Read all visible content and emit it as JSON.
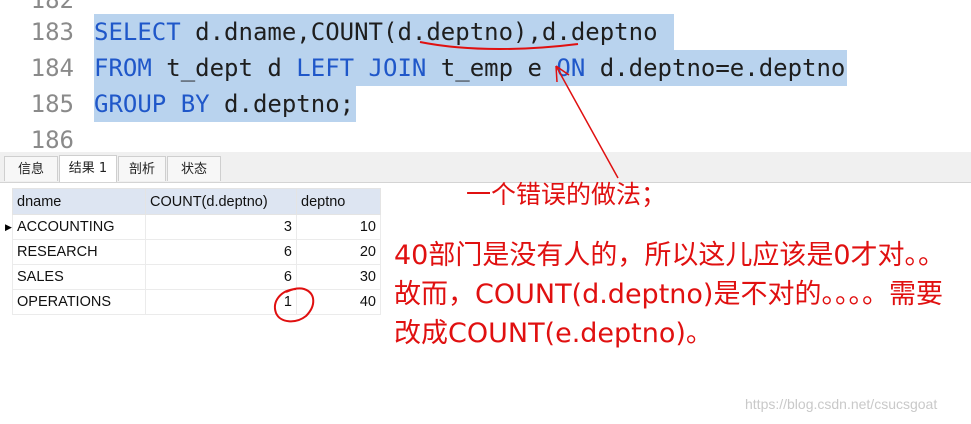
{
  "editor": {
    "lines": [
      {
        "num": "182",
        "parts": []
      },
      {
        "num": "183",
        "parts": [
          {
            "t": "SELECT",
            "kw": true
          },
          {
            "t": " d.dname,COUNT(d.deptno),d.deptno ",
            "kw": false
          }
        ]
      },
      {
        "num": "184",
        "parts": [
          {
            "t": "FROM",
            "kw": true
          },
          {
            "t": " t_dept d ",
            "kw": false
          },
          {
            "t": "LEFT JOIN",
            "kw": true
          },
          {
            "t": " t_emp e ",
            "kw": false
          },
          {
            "t": "ON",
            "kw": true
          },
          {
            "t": " d.deptno=e.deptno",
            "kw": false
          }
        ]
      },
      {
        "num": "185",
        "parts": [
          {
            "t": "GROUP BY",
            "kw": true
          },
          {
            "t": " d.deptno;",
            "kw": false
          }
        ]
      },
      {
        "num": "186",
        "parts": []
      }
    ],
    "keyword_color": "#1f57c9",
    "selection_color": "#b9d3ee"
  },
  "tabs": [
    {
      "label": "信息",
      "active": false
    },
    {
      "label": "结果 1",
      "active": true
    },
    {
      "label": "剖析",
      "active": false
    },
    {
      "label": "状态",
      "active": false
    }
  ],
  "grid": {
    "columns": [
      "dname",
      "COUNT(d.deptno)",
      "deptno"
    ],
    "rows": [
      [
        "ACCOUNTING",
        "3",
        "10"
      ],
      [
        "RESEARCH",
        "6",
        "20"
      ],
      [
        "SALES",
        "6",
        "30"
      ],
      [
        "OPERATIONS",
        "1",
        "40"
      ]
    ],
    "current_row_marker": "▶"
  },
  "annotations": {
    "note1": "一个错误的做法；",
    "note2": "40部门是没有人的，所以这儿应该是0才对。。故而，COUNT(d.deptno)是不对的。。。。需要改成COUNT(e.deptno)。",
    "color": "#e01010"
  },
  "watermark": "https://blog.csdn.net/csucsgoat"
}
